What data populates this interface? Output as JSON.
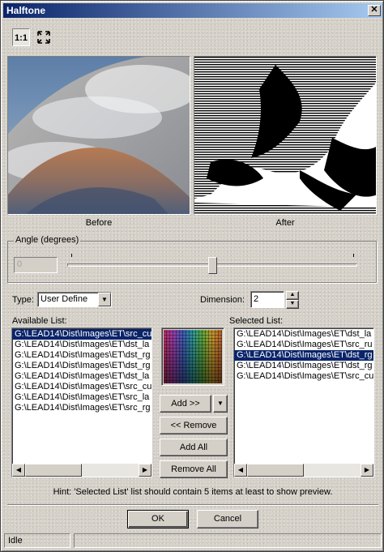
{
  "window": {
    "title": "Halftone"
  },
  "toolbar": {
    "actual_size_label": "1:1",
    "fit_icon": "fit-to-window-icon"
  },
  "preview": {
    "before_label": "Before",
    "after_label": "After"
  },
  "angle": {
    "group_label": "Angle (degrees)",
    "value": "0",
    "slider_fraction": 0.5
  },
  "type": {
    "label": "Type:",
    "selected": "User Define"
  },
  "dimension": {
    "label": "Dimension:",
    "value": "2"
  },
  "available": {
    "label": "Available List:",
    "items": [
      "G:\\LEAD14\\Dist\\Images\\ET\\src_cu",
      "G:\\LEAD14\\Dist\\Images\\ET\\dst_la",
      "G:\\LEAD14\\Dist\\Images\\ET\\dst_rg",
      "G:\\LEAD14\\Dist\\Images\\ET\\dst_rg",
      "G:\\LEAD14\\Dist\\Images\\ET\\dst_la",
      "G:\\LEAD14\\Dist\\Images\\ET\\src_cu",
      "G:\\LEAD14\\Dist\\Images\\ET\\src_la",
      "G:\\LEAD14\\Dist\\Images\\ET\\src_rg"
    ]
  },
  "selected": {
    "label": "Selected List:",
    "items": [
      "G:\\LEAD14\\Dist\\Images\\ET\\dst_la",
      "G:\\LEAD14\\Dist\\Images\\ET\\src_ru",
      "G:\\LEAD14\\Dist\\Images\\ET\\dst_rg",
      "G:\\LEAD14\\Dist\\Images\\ET\\dst_rg",
      "G:\\LEAD14\\Dist\\Images\\ET\\src_cu"
    ]
  },
  "buttons": {
    "add": "Add >>",
    "remove": "<< Remove",
    "add_all": "Add All",
    "remove_all": "Remove All",
    "ok": "OK",
    "cancel": "Cancel"
  },
  "hint": "Hint: 'Selected List' list should contain 5 items at least to show preview.",
  "status": {
    "text": "Idle"
  },
  "colors": {
    "title_start": "#0a246a",
    "title_end": "#a6caf0",
    "selection": "#0a246a",
    "face": "#d4d0c8"
  }
}
